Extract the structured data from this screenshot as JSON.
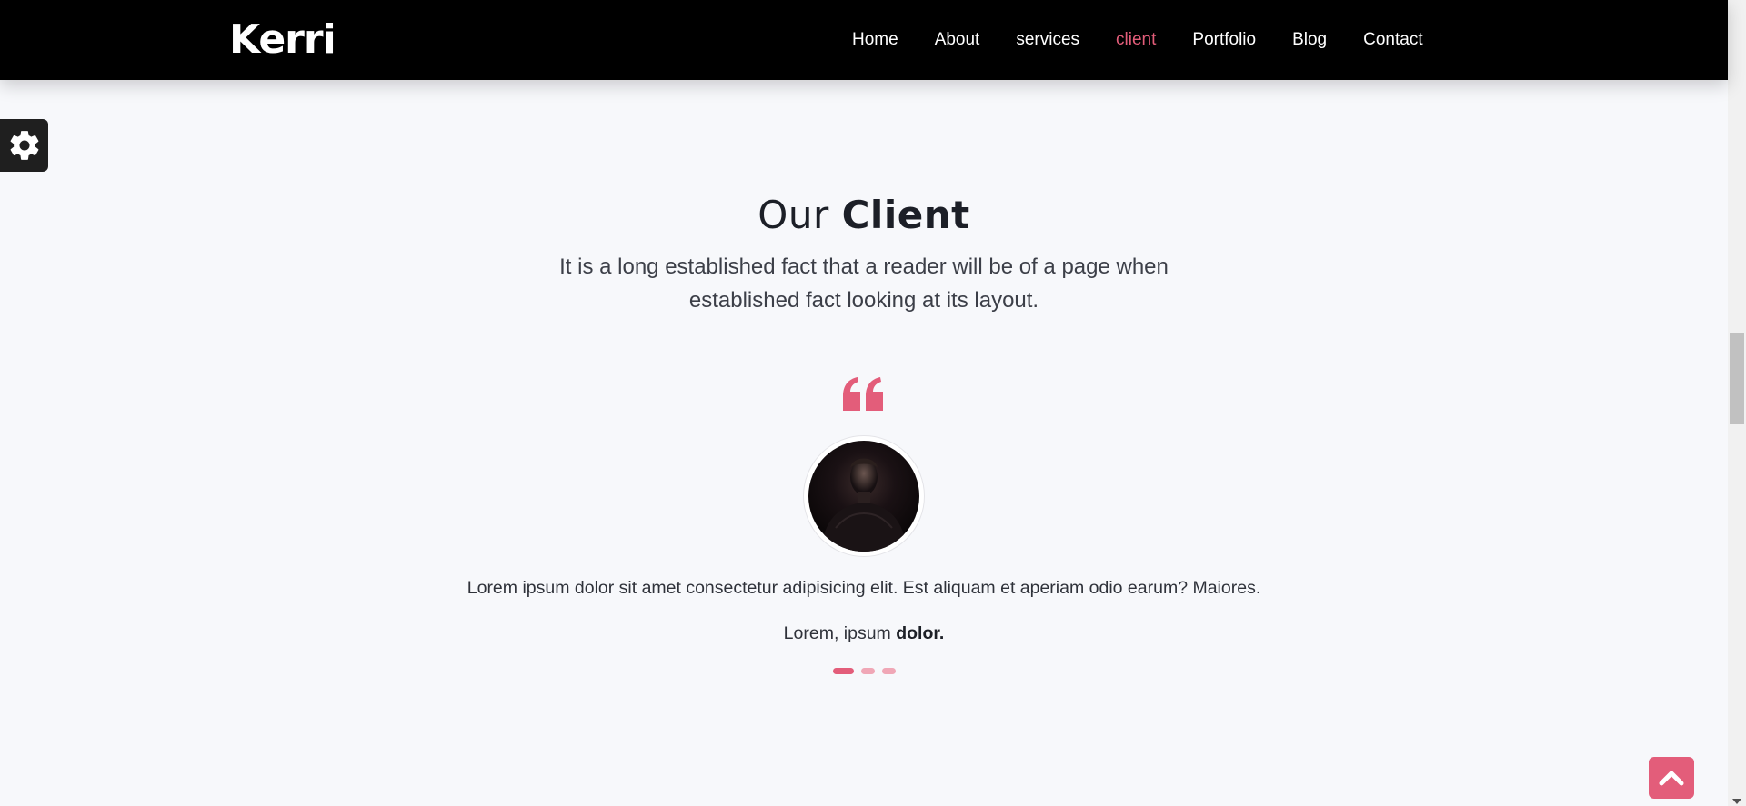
{
  "header": {
    "brand": "Kerri",
    "nav": [
      {
        "label": "Home",
        "active": false
      },
      {
        "label": "About",
        "active": false
      },
      {
        "label": "services",
        "active": false
      },
      {
        "label": "client",
        "active": true
      },
      {
        "label": "Portfolio",
        "active": false
      },
      {
        "label": "Blog",
        "active": false
      },
      {
        "label": "Contact",
        "active": false
      }
    ]
  },
  "section": {
    "title_light": "Our ",
    "title_bold": "Client",
    "subtitle": "It is a long established fact that a reader will be of a page when established fact looking at its layout."
  },
  "testimonial": {
    "quote_icon": "quote-left-icon",
    "text": "Lorem ipsum dolor sit amet consectetur adipisicing elit. Est aliquam et aperiam odio earum? Maiores.",
    "name_prefix": "Lorem, ipsum ",
    "name_bold": "dolor.",
    "slides": 3,
    "active_slide": 0
  },
  "icons": {
    "settings": "gear-icon",
    "back_to_top": "chevron-up-icon"
  },
  "colors": {
    "accent": "#e35d7a",
    "accent_light": "#f0a7b6",
    "navbar": "#000000",
    "background": "#f7f8fb"
  }
}
